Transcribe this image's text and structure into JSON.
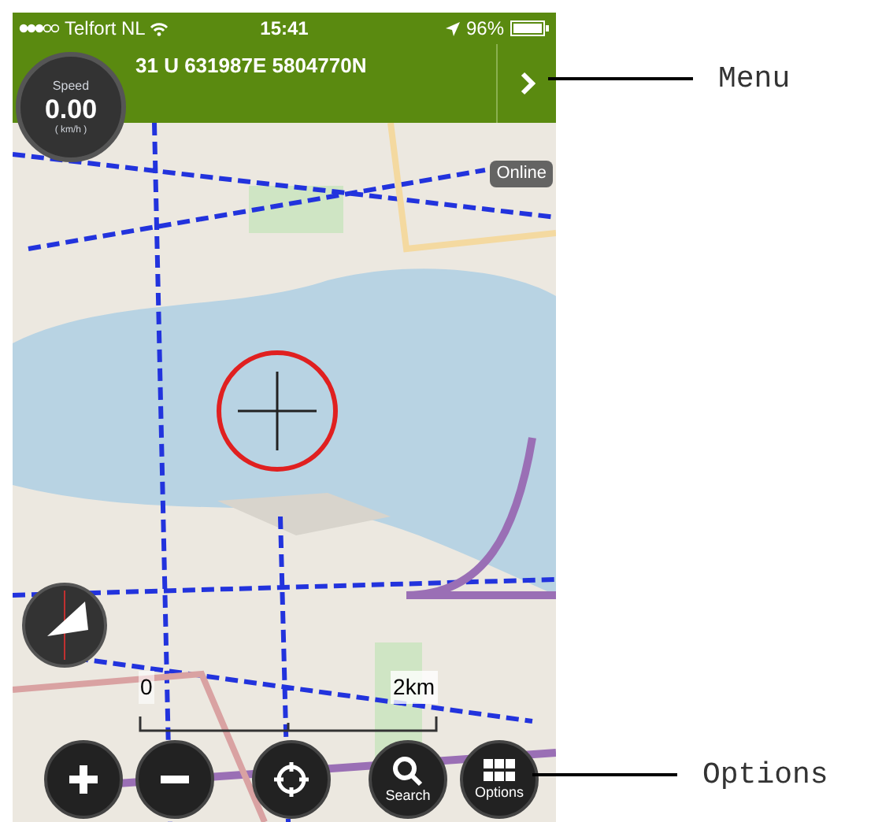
{
  "status_bar": {
    "carrier": "Telfort NL",
    "time": "15:41",
    "battery": "96%"
  },
  "header": {
    "coordinates": "31 U 631987E 5804770N"
  },
  "speed_gauge": {
    "label": "Speed",
    "value": "0.00",
    "unit": "( km/h )"
  },
  "map": {
    "online_badge": "Online",
    "scale": {
      "start": "0",
      "end": "2km"
    }
  },
  "buttons": [
    {
      "kind": "zoom_in"
    },
    {
      "kind": "zoom_out"
    },
    {
      "kind": "locate"
    },
    {
      "kind": "search",
      "label": "Search"
    },
    {
      "kind": "options",
      "label": "Options"
    }
  ],
  "annotations": [
    {
      "label": "Menu"
    },
    {
      "label": "Options"
    }
  ]
}
